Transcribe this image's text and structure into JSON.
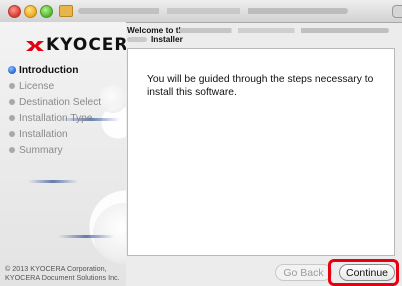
{
  "window": {
    "title_line1": "Welcome to the",
    "title_line2": "Installer"
  },
  "brand": {
    "name": "KYOCERA",
    "logo_color": "#e50012"
  },
  "sidebar": {
    "steps": [
      {
        "label": "Introduction",
        "active": true
      },
      {
        "label": "License",
        "active": false
      },
      {
        "label": "Destination Select",
        "active": false
      },
      {
        "label": "Installation Type",
        "active": false
      },
      {
        "label": "Installation",
        "active": false
      },
      {
        "label": "Summary",
        "active": false
      }
    ],
    "copyright_line1": "© 2013 KYOCERA Corporation,",
    "copyright_line2": "KYOCERA Document Solutions Inc."
  },
  "content": {
    "message": "You will be guided through the steps necessary to install this software."
  },
  "buttons": {
    "back_label": "Go Back",
    "continue_label": "Continue"
  },
  "colors": {
    "highlight": "#e50012",
    "active_step": "#2f6fd6"
  }
}
